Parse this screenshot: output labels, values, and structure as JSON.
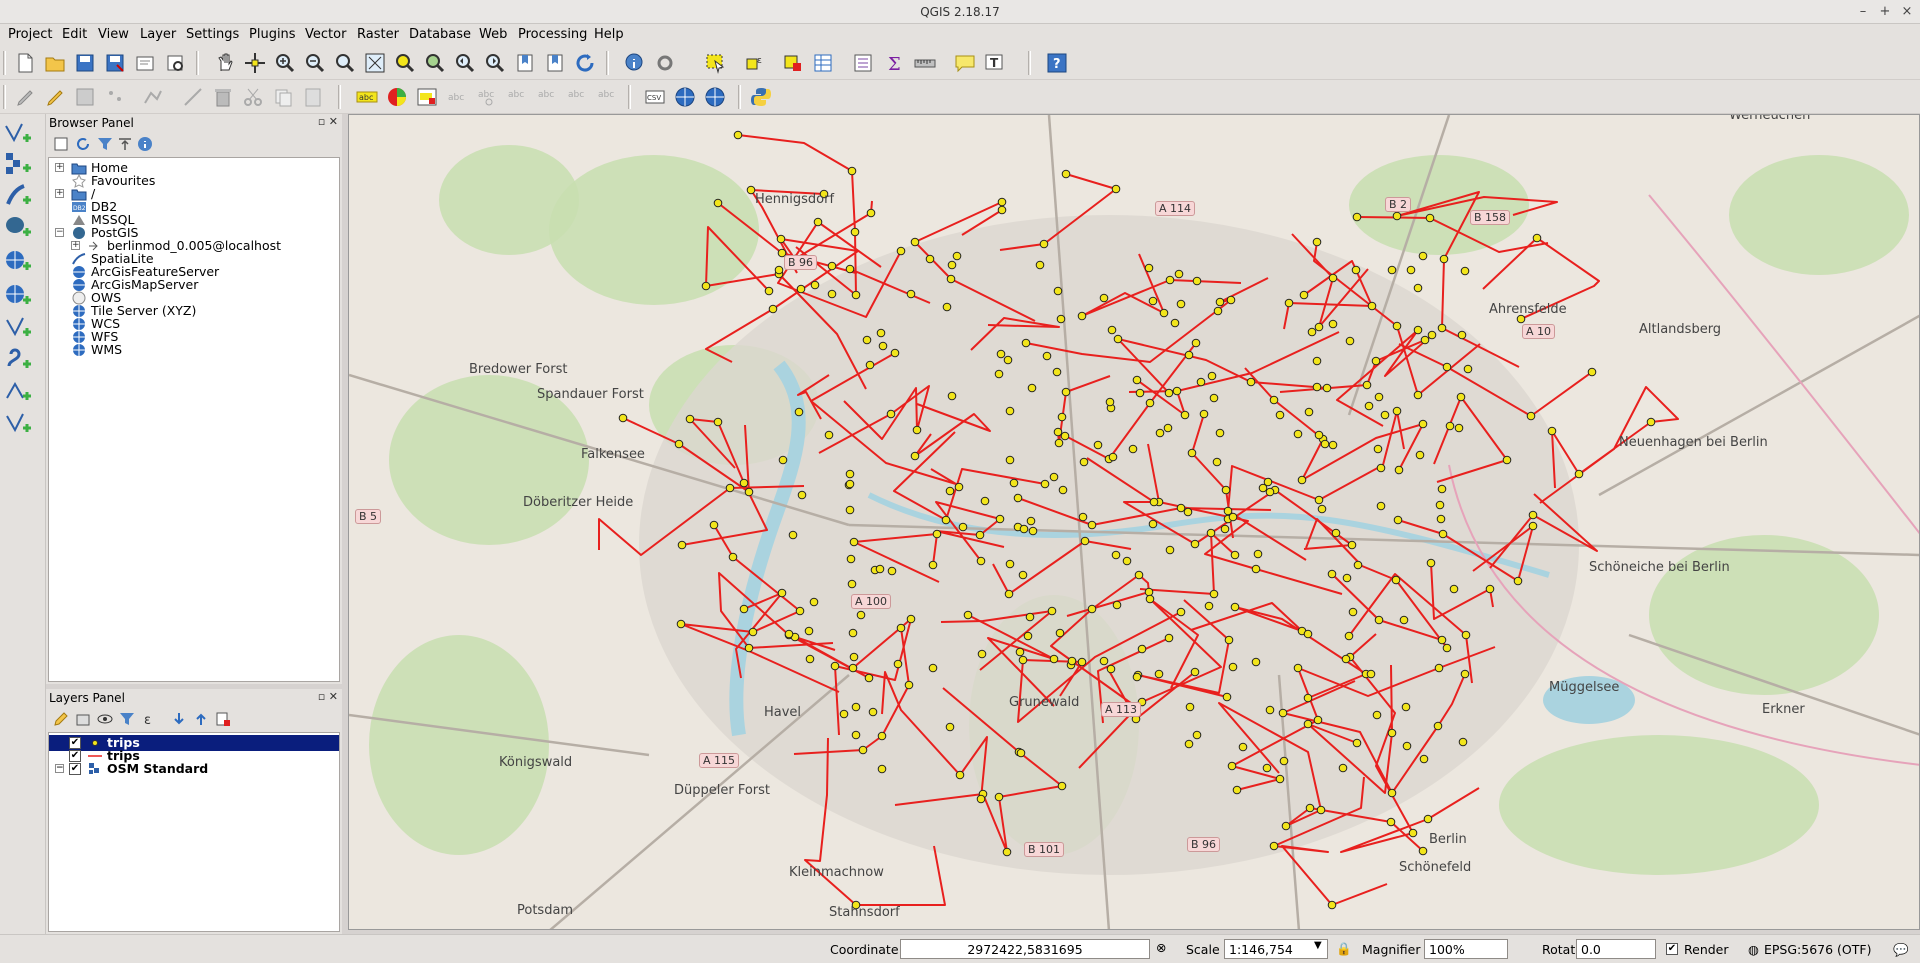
{
  "window": {
    "title": "QGIS 2.18.17",
    "controls": [
      "–",
      "+",
      "×"
    ]
  },
  "menu": [
    "Project",
    "Edit",
    "View",
    "Layer",
    "Settings",
    "Plugins",
    "Vector",
    "Raster",
    "Database",
    "Web",
    "Processing",
    "Help"
  ],
  "browser": {
    "title": "Browser Panel",
    "items": [
      {
        "label": "Home",
        "icon": "folder-icon",
        "expandable": true,
        "indent": 0
      },
      {
        "label": "Favourites",
        "icon": "star-icon",
        "expandable": false,
        "indent": 0
      },
      {
        "label": "/",
        "icon": "folder-icon",
        "expandable": true,
        "indent": 0
      },
      {
        "label": "DB2",
        "icon": "db2-icon",
        "expandable": false,
        "indent": 0
      },
      {
        "label": "MSSQL",
        "icon": "mssql-icon",
        "expandable": false,
        "indent": 0
      },
      {
        "label": "PostGIS",
        "icon": "postgis-icon",
        "expandable": true,
        "expanded": true,
        "indent": 0
      },
      {
        "label": "berlinmod_0.005@localhost",
        "icon": "connection-icon",
        "expandable": true,
        "indent": 1
      },
      {
        "label": "SpatiaLite",
        "icon": "spatialite-icon",
        "expandable": false,
        "indent": 0
      },
      {
        "label": "ArcGisFeatureServer",
        "icon": "arcgis-icon",
        "expandable": false,
        "indent": 0
      },
      {
        "label": "ArcGisMapServer",
        "icon": "arcgis-icon",
        "expandable": false,
        "indent": 0
      },
      {
        "label": "OWS",
        "icon": "ows-icon",
        "expandable": false,
        "indent": 0
      },
      {
        "label": "Tile Server (XYZ)",
        "icon": "xyz-icon",
        "expandable": false,
        "indent": 0
      },
      {
        "label": "WCS",
        "icon": "wcs-icon",
        "expandable": false,
        "indent": 0
      },
      {
        "label": "WFS",
        "icon": "wfs-icon",
        "expandable": false,
        "indent": 0
      },
      {
        "label": "WMS",
        "icon": "wms-icon",
        "expandable": false,
        "indent": 0
      }
    ]
  },
  "layers": {
    "title": "Layers Panel",
    "items": [
      {
        "label": "trips",
        "symbol": "point",
        "checked": true,
        "selected": true
      },
      {
        "label": "trips",
        "symbol": "line",
        "checked": true,
        "selected": false
      },
      {
        "label": "OSM Standard",
        "symbol": "raster",
        "checked": true,
        "selected": false
      }
    ]
  },
  "map": {
    "labels": [
      "Hennigsdorf",
      "Falkensee",
      "Döberitzer Heide",
      "Potsdam",
      "Kleinmachnow",
      "Stahnsdorf",
      "Grunewald",
      "Schönefeld",
      "Ahrensfelde",
      "Altlandsberg",
      "Neuenhagen bei Berlin",
      "Schöneiche bei Berlin",
      "Erkner",
      "Müggelsee",
      "Werneuchen",
      "Bredower Forst",
      "Spandauer Forst",
      "Düppeler Forst",
      "Königswald",
      "Havel",
      "Berlin"
    ],
    "shields": [
      "A 114",
      "B 2",
      "B 158",
      "A 10",
      "B 96",
      "A 100",
      "A 115",
      "A 113",
      "B 101",
      "B 5",
      "B 96"
    ],
    "colors": {
      "trip_line": "#e8201e",
      "trip_point": "#f2e51b",
      "map_bg": "#ece7df",
      "forest": "#c8deb0"
    }
  },
  "status": {
    "coordinate_label": "Coordinate",
    "coordinate": "2972422,5831695",
    "scale_label": "Scale",
    "scale": "1:146,754",
    "magnifier_label": "Magnifier",
    "magnifier": "100%",
    "rotation_label": "Rotation",
    "rotation": "0.0",
    "render_label": "Render",
    "crs": "EPSG:5676 (OTF)"
  }
}
